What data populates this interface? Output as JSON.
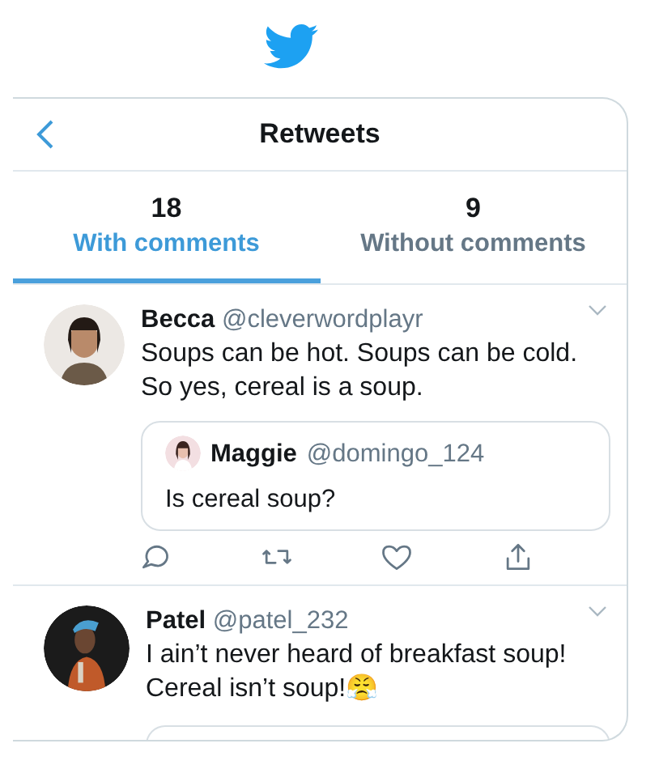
{
  "header": {
    "title": "Retweets"
  },
  "tabs": [
    {
      "count": "18",
      "label": "With comments",
      "selected": true
    },
    {
      "count": "9",
      "label": "Without comments",
      "selected": false
    }
  ],
  "tweets": [
    {
      "name": "Becca",
      "handle": "@cleverwordplayr",
      "text": "Soups can be hot. Soups can be cold. So yes, cereal is a soup.",
      "quote": {
        "name": "Maggie",
        "handle": "@domingo_124",
        "text": "Is cereal soup?"
      },
      "actions": true
    },
    {
      "name": "Patel",
      "handle": "@patel_232",
      "text": "I ain’t never heard of breakfast soup! Cereal isn’t soup!😤",
      "quote_cut": true,
      "actions": false
    }
  ]
}
